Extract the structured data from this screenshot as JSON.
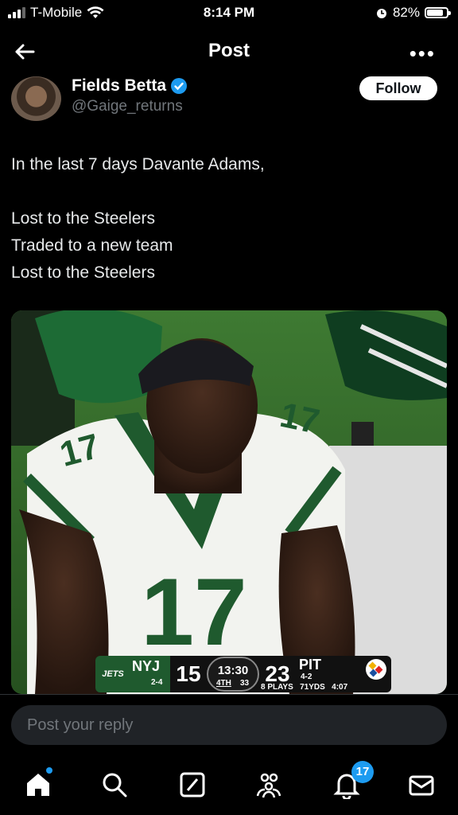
{
  "status_bar": {
    "carrier": "T-Mobile",
    "time": "8:14 PM",
    "battery": "82%",
    "battery_level": 0.82
  },
  "nav": {
    "title": "Post"
  },
  "author": {
    "name": "Fields Betta",
    "handle": "@Gaige_returns",
    "follow_label": "Follow"
  },
  "tweet": {
    "lines": [
      "In the last 7 days Davante Adams,",
      "",
      "Lost to the Steelers",
      "Traded to a new team",
      "Lost to the Steelers"
    ]
  },
  "media": {
    "jersey_number": "17",
    "scorebug": {
      "away_brand": "JETS",
      "away_team": "NYJ",
      "away_record": "2-4",
      "away_score": "15",
      "clock": "13:30",
      "quarter": "4TH",
      "play_clock": "33",
      "home_score": "23",
      "home_team": "PIT",
      "home_record": "4-2",
      "drive": {
        "plays": "8 PLAYS",
        "yards": "71YDS",
        "time": "4:07"
      }
    }
  },
  "reply": {
    "placeholder": "Post your reply"
  },
  "tabbar": {
    "notifications_count": "17"
  },
  "colors": {
    "accent": "#1d9bf0",
    "background": "#000000",
    "jets_green": "#1f5a2e"
  }
}
